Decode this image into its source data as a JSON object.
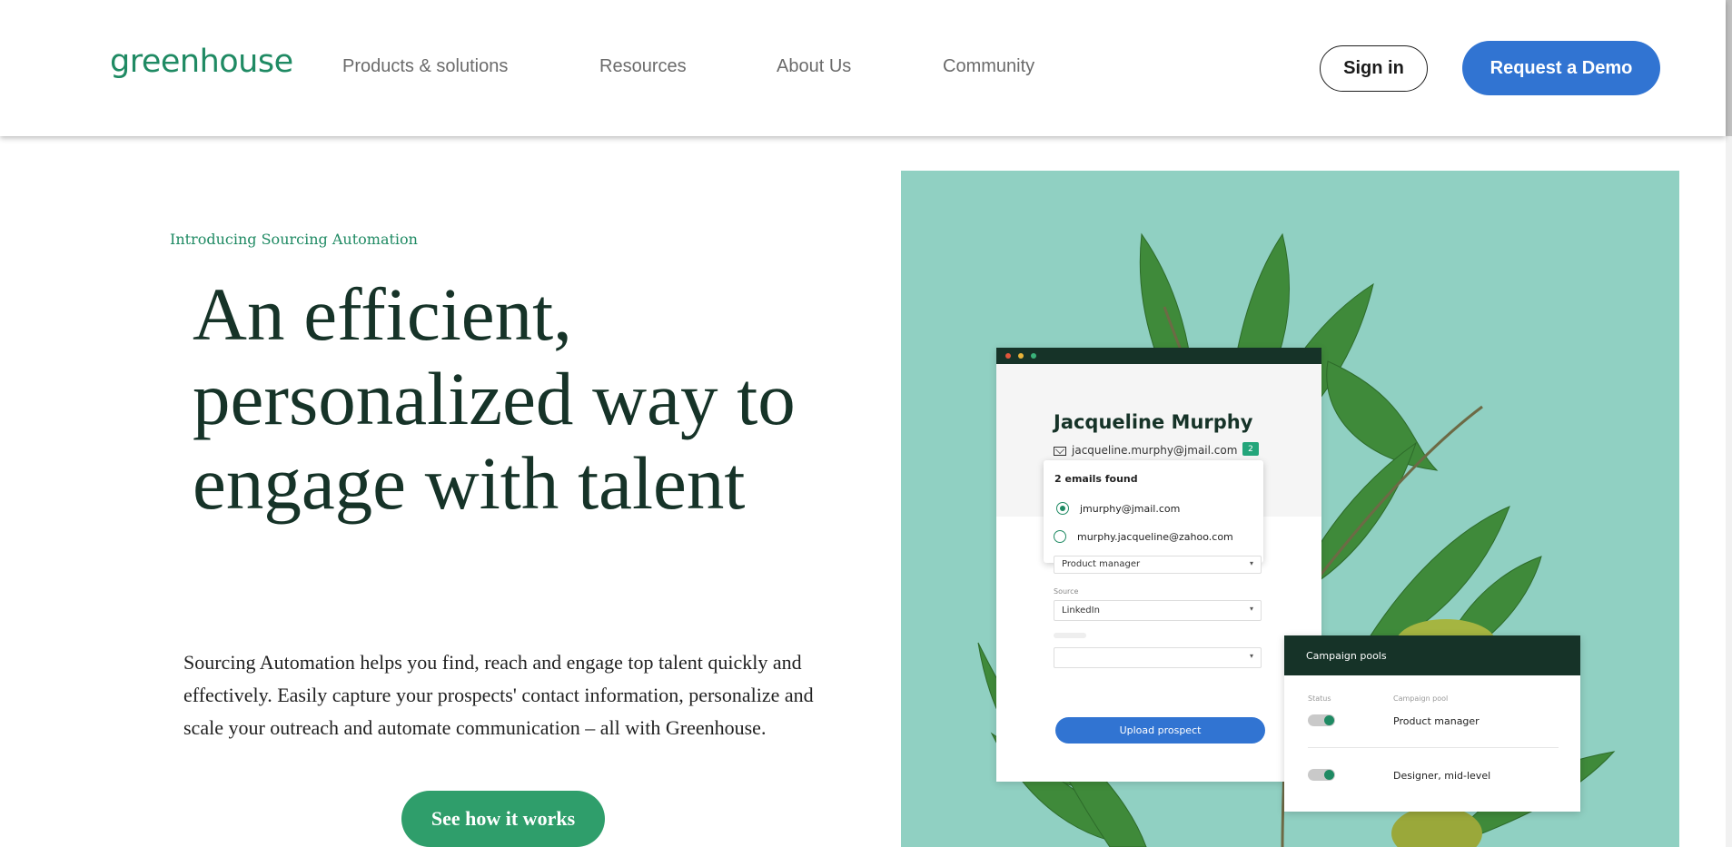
{
  "header": {
    "logo": "greenhouse",
    "nav": [
      "Products & solutions",
      "Resources",
      "About Us",
      "Community"
    ],
    "sign_in": "Sign in",
    "request_demo": "Request a Demo"
  },
  "hero": {
    "eyebrow": "Introducing Sourcing Automation",
    "headline": "An efficient, personalized way to engage with talent",
    "body": "Sourcing Automation helps you find, reach and engage top talent quickly and effectively. Easily capture your prospects' contact information, personalize and scale your outreach and automate communication – all with Greenhouse.",
    "cta": "See how it works"
  },
  "profile_card": {
    "name": "Jacqueline Murphy",
    "email": "jacqueline.murphy@jmail.com",
    "email_count": "2",
    "popover_title": "2 emails found",
    "options": [
      "jmurphy@jmail.com",
      "murphy.jacqueline@zahoo.com"
    ],
    "job_value": "Product manager",
    "source_label": "Source",
    "source_value": "LinkedIn",
    "upload_button": "Upload prospect"
  },
  "campaign_card": {
    "title": "Campaign pools",
    "status_label": "Status",
    "pool_label": "Campaign pool",
    "pools": [
      "Product manager",
      "Designer, mid-level"
    ]
  },
  "colors": {
    "brand_green": "#1f8a63",
    "dark_green": "#163328",
    "primary_blue": "#3174d2",
    "cta_green": "#2f9e6b",
    "hero_bg": "#90d0c2"
  }
}
